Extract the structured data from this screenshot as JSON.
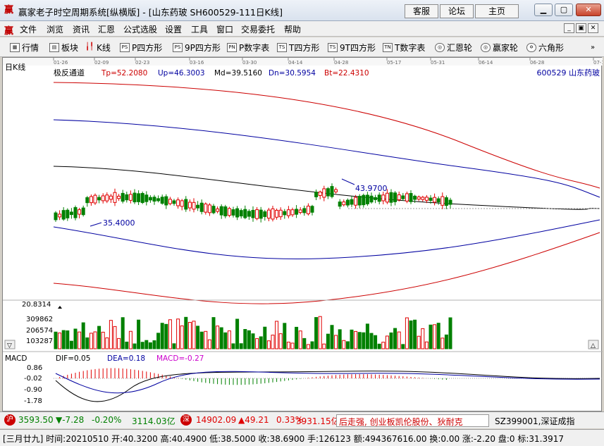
{
  "window": {
    "title": "赢家老子时空周期系统[纵横版] - [山东药玻  SH600529-111日K线]",
    "buttons": [
      "客服",
      "论坛",
      "主页"
    ]
  },
  "menu": [
    "文件",
    "浏览",
    "资讯",
    "汇恩",
    "公式选股",
    "设置",
    "工具",
    "窗口",
    "交易委托",
    "帮助"
  ],
  "toolbar": [
    "行情",
    "板块",
    "K线",
    "P四方形",
    "9P四方形",
    "P数字表",
    "T四方形",
    "9T四方形",
    "T数字表",
    "汇恩轮",
    "赢家轮",
    "六角形"
  ],
  "toolbar_icons": [
    "grid-icon",
    "blocks-icon",
    "candles-icon",
    "PS",
    "PS",
    "PN",
    "TS",
    "TS",
    "TN",
    "wheel-icon",
    "wheel-icon",
    "hexagon-icon"
  ],
  "chart": {
    "period_label": "日K线",
    "dates": [
      "01-26",
      "02-09",
      "02-23",
      "03-16",
      "03-30",
      "04-14",
      "04-28",
      "05-17",
      "05-31",
      "06-14",
      "06-28",
      "07-1"
    ],
    "indicator_name": "极反通道",
    "tp": "Tp=52.2080",
    "up": "Up=46.3003",
    "md": "Md=39.5160",
    "dn": "Dn=30.5954",
    "bt": "Bt=22.4310",
    "stock_label": "600529  山东药玻",
    "high_label": "43.9700",
    "low_label": "35.4000",
    "vol_axis": [
      "20.8314",
      "309862",
      "206574",
      "103287"
    ],
    "macd_title": "MACD",
    "dif": "DIF=0.05",
    "dea": "DEA=0.18",
    "macd": "MACD=-0.27",
    "macd_axis": [
      "0.86",
      "-0.02",
      "-0.90",
      "-1.78"
    ],
    "colors": {
      "up": "#e00000",
      "down": "#008000",
      "upper_band": "#cc0000",
      "mid_band": "#0000a0",
      "channel_mid": "#000000",
      "label_blue": "#0000a0"
    }
  },
  "status1": {
    "sh_badge": "沪",
    "sh_index": "3593.50",
    "sh_change": "▼-7.28",
    "sh_pct": "-0.20%",
    "sh_amount": "3114.03亿",
    "sz_badge": "深",
    "sz_index": "14902.09",
    "sz_change": "▲49.21",
    "sz_pct": "0.33%",
    "sz_amount": "3931.15亿",
    "ticker": "后走强, 创业板凯伦股份、狄耐克",
    "right": "SZ399001,深证成指"
  },
  "status2": {
    "text": "[三月廿九] 时间:20210510 开:40.3200 高:40.4900 低:38.5000 收:38.6900 手:126123 额:494367616.00 换:0.00 涨:-2.20 盘:0 标:31.3917"
  }
}
